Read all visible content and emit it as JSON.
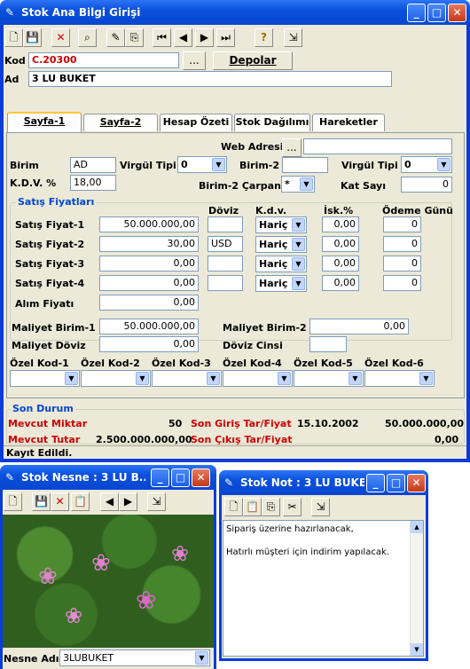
{
  "main": {
    "title": "Stok Ana Bilgi Girişi",
    "kod_label": "Kod",
    "kod_value": "C.20300",
    "kod_btn": "...",
    "depolar_btn": "Depolar",
    "ad_label": "Ad",
    "ad_value": "3 LU BUKET",
    "tabs": [
      "Sayfa-1",
      "Sayfa-2",
      "Hesap Özeti",
      "Stok Dağılımı",
      "Hareketler"
    ],
    "web_label": "Web Adresi",
    "web_btn": "...",
    "web_value": "",
    "birim_label": "Birim",
    "birim_value": "AD",
    "virgul_label": "Virgül Tipi",
    "virgul_value": "0",
    "birim2_label": "Birim-2",
    "birim2_value": "",
    "virgul2_label": "Virgül Tipi",
    "virgul2_value": "0",
    "kdv_label": "K.D.V. %",
    "kdv_value": "18,00",
    "carpan_label": "Birim-2 Çarpanı",
    "carpan_value": "*",
    "katsayi_label": "Kat Sayı",
    "katsayi_value": "0",
    "fiyat_group": "Satış Fiyatları",
    "col_doviz": "Döviz",
    "col_kdv": "K.d.v.",
    "col_isk": "İsk.%",
    "col_odeme": "Ödeme Günü",
    "rows": [
      {
        "label": "Satış Fiyat-1",
        "price": "50.000.000,00",
        "doviz": "",
        "kdv": "Hariç",
        "isk": "0,00",
        "odeme": "0"
      },
      {
        "label": "Satış Fiyat-2",
        "price": "30,00",
        "doviz": "USD",
        "kdv": "Hariç",
        "isk": "0,00",
        "odeme": "0"
      },
      {
        "label": "Satış Fiyat-3",
        "price": "0,00",
        "doviz": "",
        "kdv": "Hariç",
        "isk": "0,00",
        "odeme": "0"
      },
      {
        "label": "Satış Fiyat-4",
        "price": "0,00",
        "doviz": "",
        "kdv": "Hariç",
        "isk": "0,00",
        "odeme": "0"
      }
    ],
    "alim_label": "Alım Fiyatı",
    "alim_value": "0,00",
    "mal1_label": "Maliyet Birim-1",
    "mal1_value": "50.000.000,00",
    "mal2_label": "Maliyet Birim-2",
    "mal2_value": "0,00",
    "maldoviz_label": "Maliyet Döviz",
    "maldoviz_value": "0,00",
    "dovizcinsi_label": "Döviz Cinsi",
    "dovizcinsi_value": "",
    "ozel": [
      "Özel Kod-1",
      "Özel Kod-2",
      "Özel Kod-3",
      "Özel Kod-4",
      "Özel Kod-5",
      "Özel Kod-6"
    ],
    "son_durum": "Son Durum",
    "mevcut_miktar_label": "Mevcut Miktar",
    "mevcut_miktar": "50",
    "son_giris_label": "Son Giriş Tar/Fiyat",
    "son_giris_tarih": "15.10.2002",
    "son_giris_fiyat": "50.000.000,00",
    "mevcut_tutar_label": "Mevcut Tutar",
    "mevcut_tutar": "2.500.000.000,00",
    "son_cikis_label": "Son Çıkış Tar/Fiyat",
    "son_cikis_fiyat": "0,00",
    "status": "Kayıt Edildi."
  },
  "nesne": {
    "title": "Stok Nesne : 3 LU B...",
    "adi_label": "Nesne Adı",
    "adi_value": "3LUBUKET"
  },
  "not": {
    "title": "Stok Not : 3 LU BUKET",
    "line1": "Sipariş üzerine hazırlanacak,",
    "line2": "Hatırlı müşteri için indirim yapılacak."
  }
}
